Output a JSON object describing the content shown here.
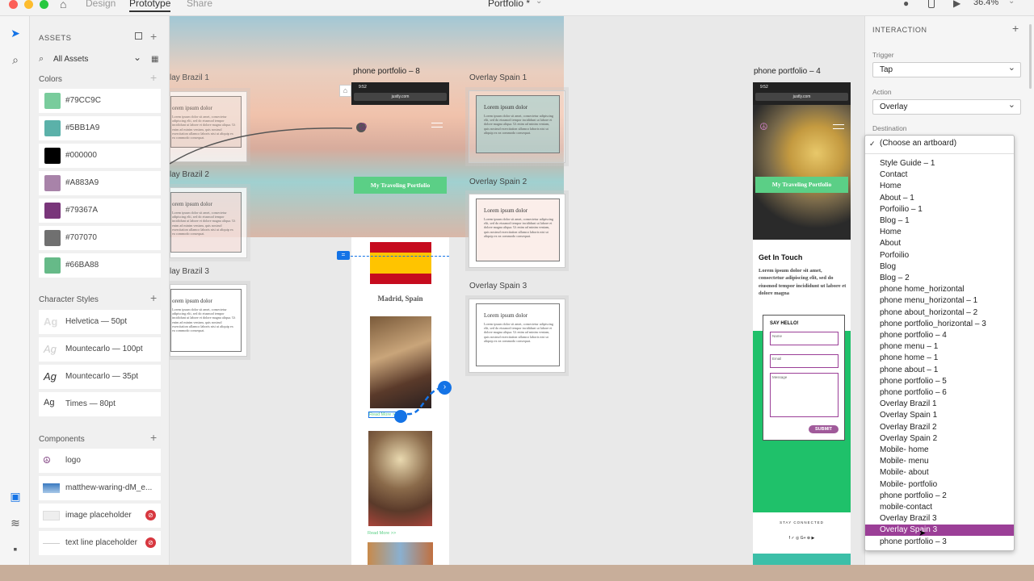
{
  "titlebar": {
    "tabs": [
      "Design",
      "Prototype",
      "Share"
    ],
    "doc_title": "Portfolio *",
    "zoom": "36.4%"
  },
  "assets": {
    "title": "ASSETS",
    "filter": "All Assets",
    "colors_title": "Colors",
    "colors": [
      {
        "hex": "#79CC9C",
        "label": "#79CC9C"
      },
      {
        "hex": "#5BB1A9",
        "label": "#5BB1A9"
      },
      {
        "hex": "#000000",
        "label": "#000000"
      },
      {
        "hex": "#A883A9",
        "label": "#A883A9"
      },
      {
        "hex": "#79367A",
        "label": "#79367A"
      },
      {
        "hex": "#707070",
        "label": "#707070"
      },
      {
        "hex": "#66BA88",
        "label": "#66BA88"
      }
    ],
    "char_title": "Character Styles",
    "char_styles": [
      {
        "glyph": "Ag",
        "label": "Helvetica — 50pt"
      },
      {
        "glyph": "Ag",
        "label": "Mountecarlo — 100pt"
      },
      {
        "glyph": "Ag",
        "label": "Mountecarlo — 35pt"
      },
      {
        "glyph": "Ag",
        "label": "Times — 80pt"
      }
    ],
    "comp_title": "Components",
    "components": [
      "logo",
      "matthew-waring-dM_e...",
      "image placeholder",
      "text line placeholder"
    ]
  },
  "canvas": {
    "artboards": {
      "brazil1": "lay Brazil 1",
      "brazil2": "lay Brazil 2",
      "brazil3": "lay Brazil 3",
      "portfolio8": "phone portfolio – 8",
      "spain1": "Overlay Spain 1",
      "spain2": "Overlay Spain 2",
      "spain3": "Overlay Spain 3",
      "portfolio4": "phone portfolio – 4"
    },
    "overlay_title": "Lorem ipsum dolor",
    "overlay_cut_title": "orem ipsum dolor",
    "overlay_body": "Lorem ipsum dolor sit amet, consectetur adipiscing elit, sed do eiusmod tempor incididunt ut labore et dolore magna aliqua. Ut enim ad minim veniam, quis nostrud exercitation ullamco laboris nisi ut aliquip ex ea commodo consequat.",
    "phone8": {
      "time": "9:52",
      "url": "justly.com",
      "hero_btn": "My Traveling Portfolio",
      "city": "Madrid, Spain",
      "read_more": "Read More >>"
    },
    "phone4": {
      "time": "9:52",
      "url": "justly.com",
      "hero_btn": "My Traveling Portfolio",
      "get_in_touch": "Get In Touch",
      "lorem": "Lorem ipsum dolor sit amet, consectetur adipiscing elit, sed do eiusmod tempor incididunt ut labore et dolore magna",
      "say_hello": "SAY HELLO!",
      "name_ph": "Name",
      "email_ph": "Email",
      "msg_ph": "Message",
      "submit": "SUBMIT",
      "stay": "STAY CONNECTED",
      "social": "f ✓ ◎ G+ ⊕ ▶"
    }
  },
  "interaction": {
    "title": "INTERACTION",
    "trigger_label": "Trigger",
    "trigger": "Tap",
    "action_label": "Action",
    "action": "Overlay",
    "destination_label": "Destination"
  },
  "dropdown": {
    "choose": "(Choose an artboard)",
    "items": [
      "Style Guide – 1",
      "Contact",
      "Home",
      "About – 1",
      "Porfoilio – 1",
      "Blog – 1",
      "Home",
      "About",
      "Porfoilio",
      "Blog",
      "Blog – 2",
      "phone home_horizontal",
      "phone menu_horizontal – 1",
      "phone about_horizontal – 2",
      "phone portfolio_horizontal – 3",
      "phone portfolio – 4",
      "phone menu – 1",
      "phone home – 1",
      "phone about – 1",
      "phone portfolio – 5",
      "phone portfolio – 6",
      "Overlay Brazil 1",
      "Overlay Spain 1",
      "Overlay Brazil 2",
      "Overlay Spain 2",
      "Mobile- home",
      "Mobile- menu",
      "Mobile- about",
      "Mobile- portfolio",
      "phone portfolio – 2",
      "mobile-contact",
      "Overlay Brazil 3",
      "Overlay Spain 3",
      "phone portfolio – 3"
    ],
    "selected": "Overlay Spain 3"
  }
}
